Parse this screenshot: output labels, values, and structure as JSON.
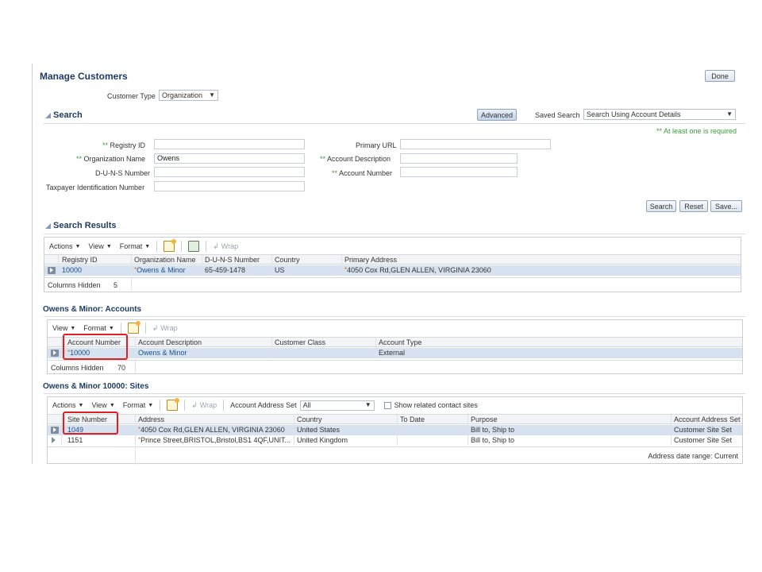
{
  "page": {
    "title": "Manage Customers",
    "done_label": "Done",
    "customer_type_label": "Customer Type",
    "customer_type_value": "Organization"
  },
  "search": {
    "title": "Search",
    "advanced_label": "Advanced",
    "saved_search_label": "Saved Search",
    "saved_search_value": "Search Using Account Details",
    "required_note": "** At least one is required",
    "fields": {
      "registry_id_label": "** Registry ID",
      "registry_id_value": "",
      "organization_name_label": "** Organization Name",
      "organization_name_value": "Owens",
      "duns_label": "D-U-N-S Number",
      "duns_value": "",
      "taxpayer_label": "Taxpayer Identification Number",
      "taxpayer_value": "",
      "primary_url_label": "Primary URL",
      "primary_url_value": "",
      "account_description_label": "** Account Description",
      "account_description_value": "",
      "account_number_label": "** Account Number",
      "account_number_value": ""
    },
    "search_button": "Search",
    "reset_button": "Reset",
    "save_button": "Save..."
  },
  "results": {
    "title": "Search Results",
    "toolbar": {
      "actions": "Actions",
      "view": "View",
      "format": "Format",
      "wrap": "Wrap"
    },
    "columns": [
      "Registry ID",
      "Organization Name",
      "D-U-N-S Number",
      "Country",
      "Primary Address"
    ],
    "rows": [
      {
        "registry_id": "10000",
        "organization_name": "Owens & Minor",
        "duns": "65-459-1478",
        "country": "US",
        "primary_address": "4050 Cox Rd,GLEN ALLEN, VIRGINIA 23060"
      }
    ],
    "columns_hidden_label": "Columns Hidden",
    "columns_hidden_count": "5"
  },
  "accounts": {
    "title": "Owens & Minor: Accounts",
    "toolbar": {
      "view": "View",
      "format": "Format",
      "wrap": "Wrap"
    },
    "columns": [
      "Account Number",
      "Account Description",
      "Customer Class",
      "Account Type"
    ],
    "rows": [
      {
        "account_number": "10000",
        "account_description": "Owens & Minor",
        "customer_class": "",
        "account_type": "External"
      }
    ],
    "columns_hidden_label": "Columns Hidden",
    "columns_hidden_count": "70"
  },
  "sites": {
    "title": "Owens & Minor 10000: Sites",
    "toolbar": {
      "actions": "Actions",
      "view": "View",
      "format": "Format",
      "wrap": "Wrap",
      "account_address_set_label": "Account Address Set",
      "account_address_set_value": "All",
      "show_related_label": "Show related contact sites"
    },
    "columns": [
      "Site Number",
      "Address",
      "Country",
      "To Date",
      "Purpose",
      "Account Address Set"
    ],
    "rows": [
      {
        "site_number": "1049",
        "address": "4050 Cox Rd,GLEN ALLEN, VIRGINIA 23060",
        "country": "United States",
        "to_date": "",
        "purpose": "Bill to, Ship to",
        "address_set": "Customer Site Set"
      },
      {
        "site_number": "1151",
        "address": "Prince Street,BRISTOL,Bristol,BS1 4QF,UNIT...",
        "country": "United Kingdom",
        "to_date": "",
        "purpose": "Bill to, Ship to",
        "address_set": "Customer Site Set"
      }
    ],
    "footer_note": "Address date range: Current"
  },
  "colors": {
    "title_blue": "#1f3b63",
    "link_blue": "#1c4f8e",
    "selected_row": "#d6e2f0",
    "highlight_red": "#e02020",
    "required_green": "#3a9c3a"
  }
}
